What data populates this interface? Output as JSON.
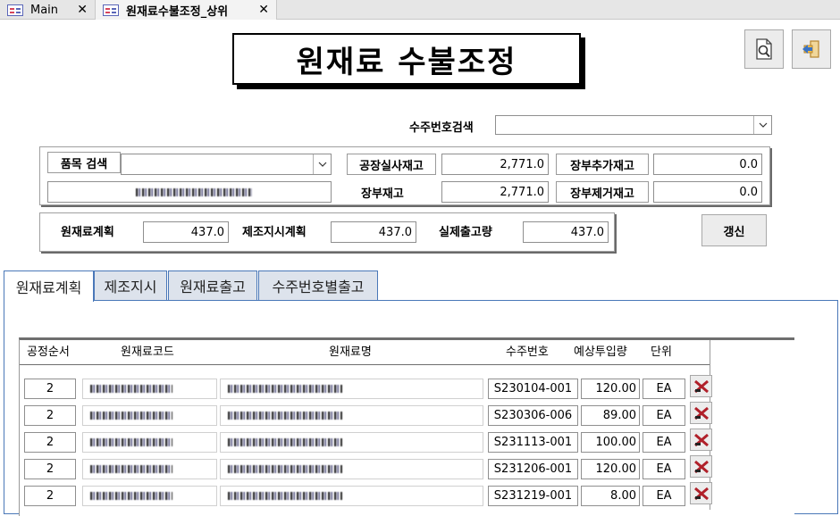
{
  "tabs": [
    {
      "label": "Main",
      "close": "✕"
    },
    {
      "label": "원재료수불조정_상위",
      "close": "✕"
    }
  ],
  "title": "원재료 수불조정",
  "header_buttons": {
    "preview_icon": "print-preview-icon",
    "exit_icon": "exit-icon"
  },
  "order_search": {
    "label": "수주번호검색",
    "value": ""
  },
  "item_search": {
    "label": "품목 검색"
  },
  "stock": {
    "factory_actual_label": "공장실사재고",
    "factory_actual_value": "2,771.0",
    "book_label": "장부재고",
    "book_value": "2,771.0",
    "book_add_label": "장부추가재고",
    "book_add_value": "0.0",
    "book_remove_label": "장부제거재고",
    "book_remove_value": "0.0"
  },
  "plan": {
    "material_plan_label": "원재료계획",
    "material_plan_value": "437.0",
    "production_plan_label": "제조지시계획",
    "production_plan_value": "437.0",
    "actual_issue_label": "실제출고량",
    "actual_issue_value": "437.0",
    "refresh_label": "갱신"
  },
  "sub_tabs": [
    "원재료계획",
    "제조지시",
    "원재료출고",
    "수주번호별출고"
  ],
  "grid": {
    "headers": [
      "공정순서",
      "원재료코드",
      "원재료명",
      "수주번호",
      "예상투입량",
      "단위"
    ],
    "rows": [
      {
        "seq": "2",
        "order_no": "S230104-001",
        "qty": "120.00",
        "unit": "EA"
      },
      {
        "seq": "2",
        "order_no": "S230306-006",
        "qty": "89.00",
        "unit": "EA"
      },
      {
        "seq": "2",
        "order_no": "S231113-001",
        "qty": "100.00",
        "unit": "EA"
      },
      {
        "seq": "2",
        "order_no": "S231206-001",
        "qty": "120.00",
        "unit": "EA"
      },
      {
        "seq": "2",
        "order_no": "S231219-001",
        "qty": "8.00",
        "unit": "EA"
      }
    ]
  },
  "colors": {
    "tab_border": "#4a78b8",
    "delete_icon": "#b0202a"
  }
}
